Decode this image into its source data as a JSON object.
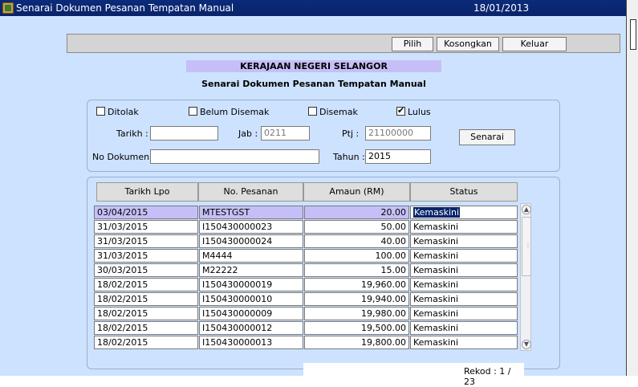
{
  "window": {
    "title": "Senarai Dokumen Pesanan Tempatan Manual",
    "date": "18/01/2013"
  },
  "toolbar": {
    "pilih": "Pilih",
    "kosongkan": "Kosongkan",
    "keluar": "Keluar"
  },
  "heading": "KERAJAAN NEGERI SELANGOR",
  "subheading": "Senarai Dokumen Pesanan Tempatan Manual",
  "filters": {
    "ditolak": {
      "label": "Ditolak",
      "checked": false
    },
    "belum_disemak": {
      "label": "Belum Disemak",
      "checked": false
    },
    "disemak": {
      "label": "Disemak",
      "checked": false
    },
    "lulus": {
      "label": "Lulus",
      "checked": true
    },
    "tarikh_label": "Tarikh :",
    "tarikh_value": "",
    "jab_label": "Jab :",
    "jab_value": "0211",
    "ptj_label": "Ptj :",
    "ptj_value": "21100000",
    "no_dokumen_label": "No Dokumen :",
    "no_dokumen_value": "",
    "tahun_label": "Tahun :",
    "tahun_value": "2015",
    "senarai_button": "Senarai"
  },
  "table": {
    "headers": [
      "Tarikh Lpo",
      "No. Pesanan",
      "Amaun (RM)",
      "Status"
    ],
    "rows": [
      {
        "tarikh": "03/04/2015",
        "no": "MTESTGST",
        "amaun": "20.00",
        "status": "Kemaskini"
      },
      {
        "tarikh": "31/03/2015",
        "no": "I150430000023",
        "amaun": "50.00",
        "status": "Kemaskini"
      },
      {
        "tarikh": "31/03/2015",
        "no": "I150430000024",
        "amaun": "40.00",
        "status": "Kemaskini"
      },
      {
        "tarikh": "31/03/2015",
        "no": "M4444",
        "amaun": "100.00",
        "status": "Kemaskini"
      },
      {
        "tarikh": "30/03/2015",
        "no": "M22222",
        "amaun": "15.00",
        "status": "Kemaskini"
      },
      {
        "tarikh": "18/02/2015",
        "no": "I150430000019",
        "amaun": "19,960.00",
        "status": "Kemaskini"
      },
      {
        "tarikh": "18/02/2015",
        "no": "I150430000010",
        "amaun": "19,940.00",
        "status": "Kemaskini"
      },
      {
        "tarikh": "18/02/2015",
        "no": "I150430000009",
        "amaun": "19,980.00",
        "status": "Kemaskini"
      },
      {
        "tarikh": "18/02/2015",
        "no": "I150430000012",
        "amaun": "19,500.00",
        "status": "Kemaskini"
      },
      {
        "tarikh": "18/02/2015",
        "no": "I150430000013",
        "amaun": "19,800.00",
        "status": "Kemaskini"
      }
    ]
  },
  "rekod": "Rekod : 1 / 23",
  "icons": {
    "app": "forms-app-icon",
    "scroll_up": "scroll-up-icon",
    "scroll_down": "scroll-down-icon"
  },
  "colors": {
    "title_bar": "#0a246a",
    "background": "#cde2ff",
    "highlight": "#c6bff7"
  }
}
